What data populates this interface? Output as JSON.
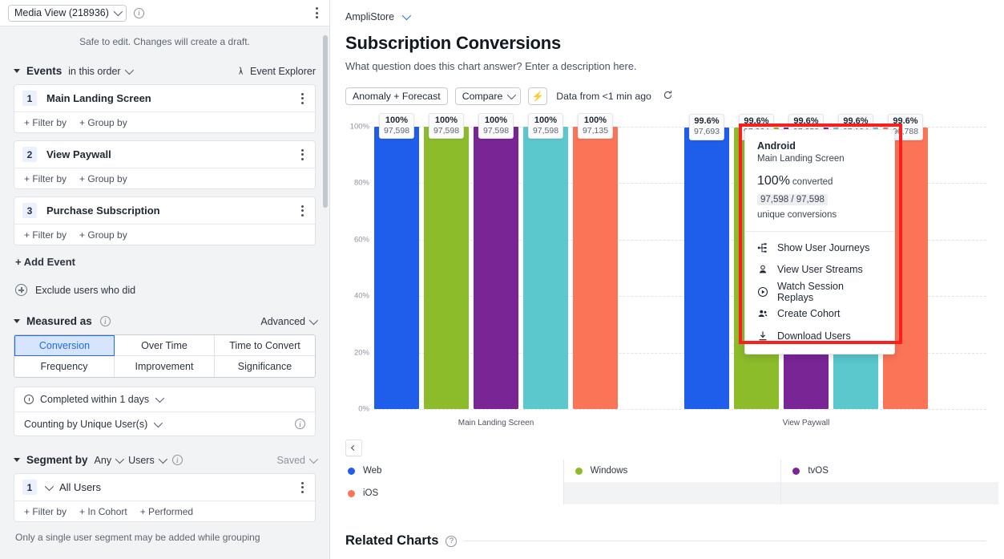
{
  "sidebar": {
    "view_selector": "Media View (218936)",
    "notice": "Safe to edit. Changes will create a draft.",
    "events_section": {
      "title": "Events",
      "order_label": "in this order",
      "explorer_label": "Event Explorer",
      "items": [
        {
          "index": "1",
          "name": "Main Landing Screen",
          "filter_by": "+ Filter by",
          "group_by": "+ Group by"
        },
        {
          "index": "2",
          "name": "View Paywall",
          "filter_by": "+ Filter by",
          "group_by": "+ Group by"
        },
        {
          "index": "3",
          "name": "Purchase Subscription",
          "filter_by": "+ Filter by",
          "group_by": "+ Group by"
        }
      ],
      "add_event": "+ Add Event",
      "exclude": "Exclude users who did"
    },
    "measured_as": {
      "title": "Measured as",
      "advanced": "Advanced",
      "tabs": [
        "Conversion",
        "Over Time",
        "Time to Convert",
        "Frequency",
        "Improvement",
        "Significance"
      ],
      "active_tab": "Conversion",
      "window": "Completed within 1 days",
      "counting": "Counting by Unique User(s)"
    },
    "segment_by": {
      "title": "Segment by",
      "any": "Any",
      "users": "Users",
      "saved": "Saved",
      "rows": [
        {
          "index": "1",
          "name": "All Users",
          "filter_by": "+ Filter by",
          "in_cohort": "+ In Cohort",
          "performed": "+ Performed"
        }
      ],
      "note": "Only a single user segment may be added while grouping"
    }
  },
  "main": {
    "breadcrumb": "AmpliStore",
    "title": "Subscription Conversions",
    "description": "What question does this chart answer? Enter a description here.",
    "toolbar": {
      "anomaly_forecast": "Anomaly + Forecast",
      "compare": "Compare",
      "data_age": "Data from <1 min ago"
    },
    "related_charts": "Related Charts"
  },
  "popover": {
    "title": "Android",
    "subtitle": "Main Landing Screen",
    "value": "100%",
    "value_unit": "converted",
    "fraction": "97,598 / 97,598",
    "unit_label": "unique conversions",
    "menu": [
      {
        "icon": "user-journeys-icon",
        "label": "Show User Journeys"
      },
      {
        "icon": "user-streams-icon",
        "label": "View User Streams"
      },
      {
        "icon": "session-replays-icon",
        "label": "Watch Session Replays"
      },
      {
        "icon": "create-cohort-icon",
        "label": "Create Cohort"
      },
      {
        "icon": "download-users-icon",
        "label": "Download Users"
      }
    ]
  },
  "colors": {
    "Web": "#1f5eea",
    "Windows": "#8cbc2a",
    "tvOS": "#7a2596",
    "Android": "#5bc8cd",
    "iOS": "#fc7457",
    "accent": "#1f6af0",
    "highlight_box": "#fc1d1d"
  },
  "chart_data": {
    "type": "bar",
    "title": "Subscription Conversions",
    "xlabel": "",
    "ylabel": "",
    "ylim": [
      0,
      100
    ],
    "yticks": [
      "0%",
      "20%",
      "40%",
      "60%",
      "80%",
      "100%"
    ],
    "grid": true,
    "legend_position": "bottom",
    "categories": [
      "Main Landing Screen",
      "View Paywall"
    ],
    "series": [
      {
        "name": "Web",
        "color": "#1f5eea",
        "percents": [
          100,
          99.6
        ],
        "labels": [
          "100%",
          "99.6%"
        ],
        "counts": [
          "97,598",
          "97,693"
        ]
      },
      {
        "name": "Windows",
        "color": "#8cbc2a",
        "percents": [
          100,
          99.6
        ],
        "labels": [
          "100%",
          "99.6%"
        ],
        "counts": [
          "97,598",
          "97,324"
        ]
      },
      {
        "name": "tvOS",
        "color": "#7a2596",
        "percents": [
          100,
          99.6
        ],
        "labels": [
          "100%",
          "99.6%"
        ],
        "counts": [
          "97,598",
          "97,258"
        ]
      },
      {
        "name": "Android",
        "color": "#5bc8cd",
        "percents": [
          100,
          99.6
        ],
        "labels": [
          "100%",
          "99.6%"
        ],
        "counts": [
          "97,598",
          "97,194"
        ]
      },
      {
        "name": "iOS",
        "color": "#fc7457",
        "percents": [
          100,
          99.6
        ],
        "labels": [
          "100%",
          "99.6%"
        ],
        "counts": [
          "97,135",
          "96,788"
        ]
      }
    ],
    "legend": [
      {
        "name": "Web",
        "color": "#1f5eea"
      },
      {
        "name": "Windows",
        "color": "#8cbc2a"
      },
      {
        "name": "tvOS",
        "color": "#7a2596"
      },
      {
        "name": "iOS",
        "color": "#fc7457"
      }
    ]
  }
}
